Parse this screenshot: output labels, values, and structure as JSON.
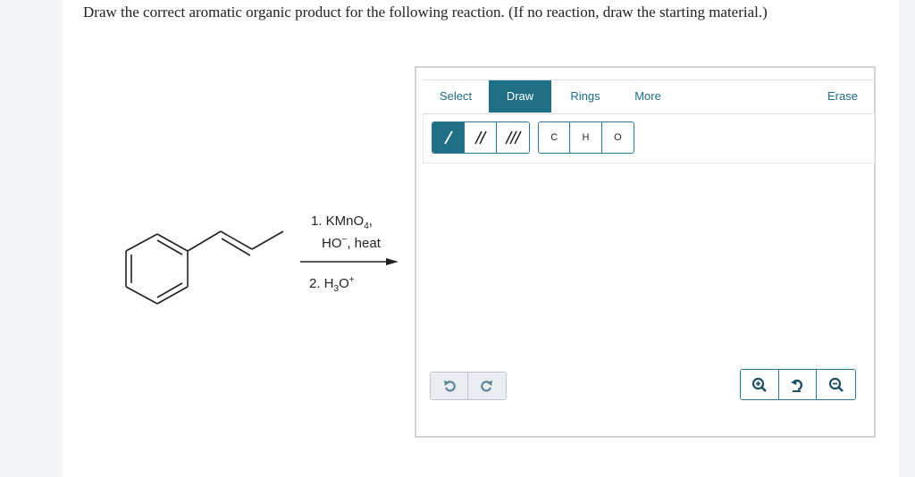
{
  "question": {
    "text": "Draw the correct aromatic organic product for the following reaction. (If no reaction, draw the starting material.)"
  },
  "scheme": {
    "step1_prefix": "1. KMnO",
    "step1_sub": "4",
    "step1_suffix": ",",
    "step1_line2_base": "HO",
    "step1_line2_sup": "−",
    "step1_line2_rest": ", heat",
    "step2_prefix": "2. H",
    "step2_sub": "3",
    "step2_mid": "O",
    "step2_sup": "+"
  },
  "editor": {
    "tabs": [
      {
        "label": "Select",
        "active": false
      },
      {
        "label": "Draw",
        "active": true
      },
      {
        "label": "Rings",
        "active": false
      },
      {
        "label": "More",
        "active": false
      },
      {
        "label": "Erase",
        "active": false
      }
    ],
    "bond_tools": [
      "single-bond",
      "double-bond",
      "triple-bond"
    ],
    "atoms": [
      "C",
      "H",
      "O"
    ],
    "undo_redo": [
      "undo",
      "redo"
    ],
    "zoom": [
      "zoom-in",
      "reset-zoom",
      "zoom-out"
    ]
  },
  "colors": {
    "accent": "#1f6f86",
    "text": "#222222",
    "border": "#d4d4d4"
  }
}
